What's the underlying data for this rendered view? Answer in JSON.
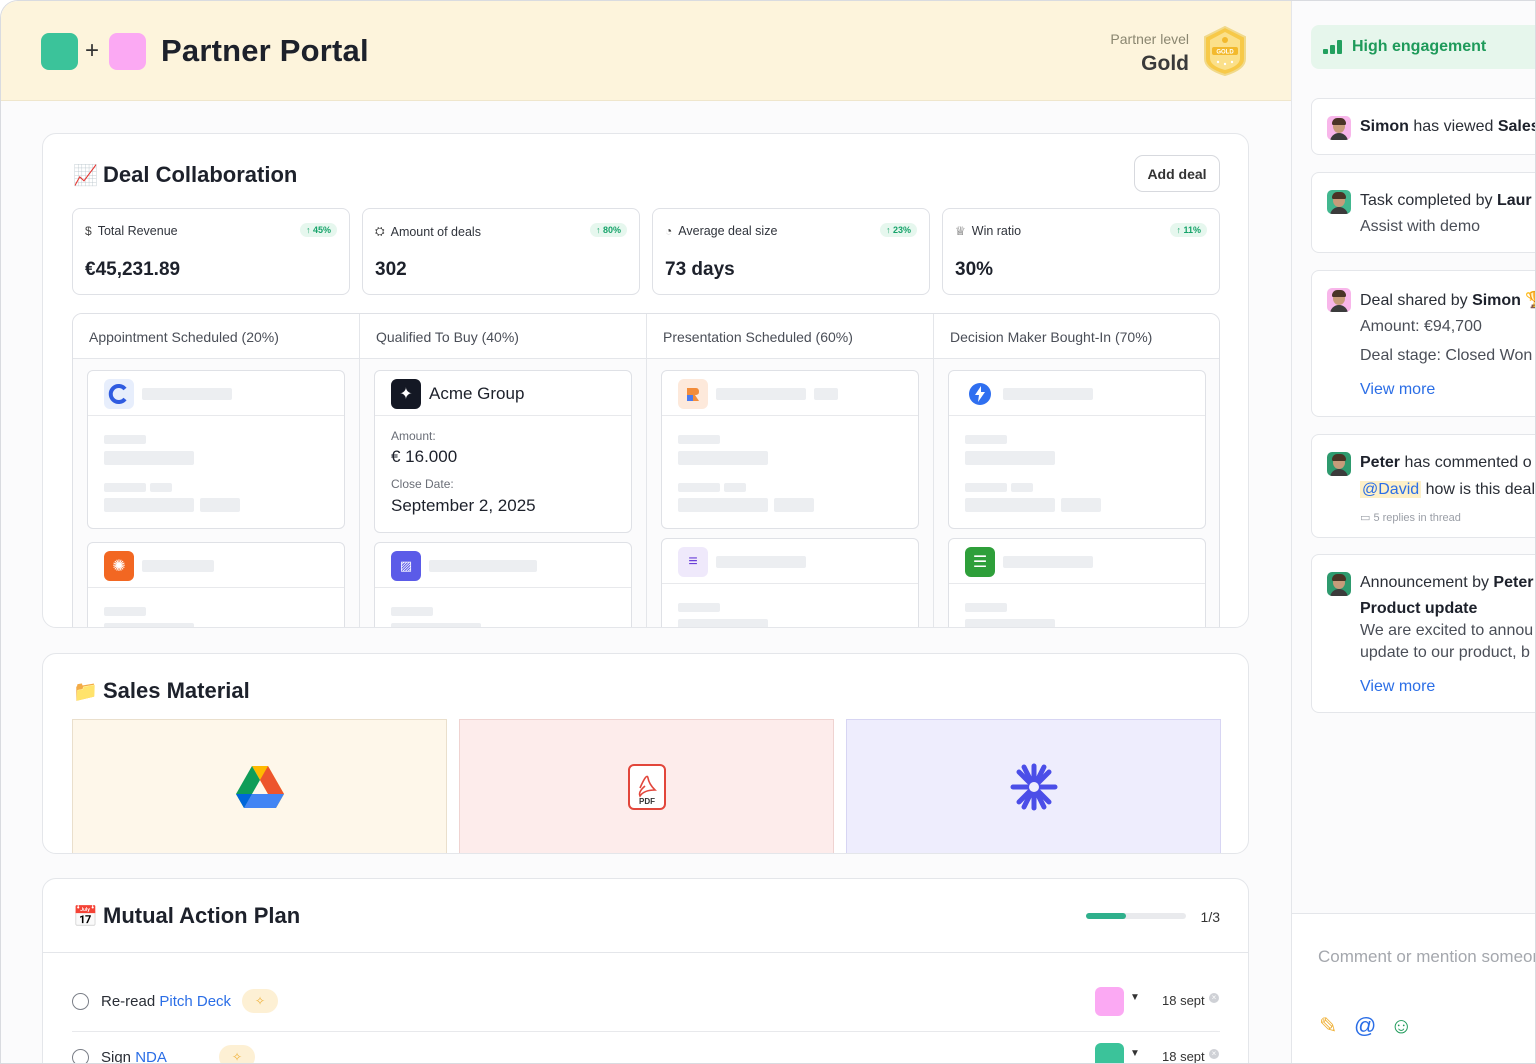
{
  "app": {
    "title": "Partner Portal",
    "logo_plus": "+",
    "partner_level_label": "Partner level",
    "partner_level": "Gold",
    "badge_text": "GOLD"
  },
  "deal_collaboration": {
    "title": "Deal Collaboration",
    "icon": "chart-increasing-icon",
    "add_button": "Add deal",
    "stats": [
      {
        "icon": "dollar-icon",
        "label": "Total Revenue",
        "delta": "↑ 45%",
        "value": "€45,231.89"
      },
      {
        "icon": "handshake-icon",
        "label": "Amount of deals",
        "delta": "↑ 80%",
        "value": "302"
      },
      {
        "icon": "pie-chart-icon",
        "label": "Average deal size",
        "delta": "↑ 23%",
        "value": "73 days"
      },
      {
        "icon": "trophy-icon",
        "label": "Win ratio",
        "delta": "↑ 11%",
        "value": "30%"
      }
    ],
    "stages": [
      {
        "label": "Appointment Scheduled (20%)"
      },
      {
        "label": "Qualified To Buy (40%)"
      },
      {
        "label": "Presentation Scheduled (60%)"
      },
      {
        "label": "Decision Maker Bought-In (70%)"
      }
    ],
    "featured_deal": {
      "company": "Acme Group",
      "amount_label": "Amount:",
      "amount": "€ 16.000",
      "close_label": "Close Date:",
      "close_date": "September 2, 2025"
    }
  },
  "sales_material": {
    "title": "Sales Material",
    "icon": "folder-icon",
    "items": [
      {
        "icon": "google-drive-icon",
        "bg": "#fef7ea"
      },
      {
        "icon": "pdf-icon",
        "label": "PDF",
        "bg": "#fdeceb"
      },
      {
        "icon": "asterisk-icon",
        "bg": "#eeedfd"
      }
    ]
  },
  "mutual_action_plan": {
    "title": "Mutual Action Plan",
    "icon": "calendar-icon",
    "progress": 0.4,
    "progress_text": "1/3",
    "tasks": [
      {
        "prefix": "Re-read ",
        "link": "Pitch Deck",
        "owner_color": "#fba9f3",
        "date": "18 sept"
      },
      {
        "prefix": "Sign ",
        "link": "NDA",
        "owner_color": "#3bc39a",
        "date": "18 sept"
      }
    ]
  },
  "activity": {
    "engagement": "High engagement",
    "feed": [
      {
        "actor": "Simon",
        "text": " has viewed ",
        "object": "Sales"
      },
      {
        "text": "Task completed by ",
        "actor": "Laur",
        "detail": "Assist with demo"
      },
      {
        "text": "Deal shared by ",
        "actor": "Simon",
        "trophy": "🏆",
        "amount": "Amount: €94,700",
        "stage": "Deal stage: Closed Won",
        "link": "View more"
      },
      {
        "actor": "Peter",
        "text": " has commented o",
        "mention": "@David",
        "comment": " how is this deal g",
        "replies": "5 replies in thread"
      },
      {
        "text": "Announcement by ",
        "actor": "Peter",
        "headline": "Product update",
        "body1": "We are excited to annou",
        "body2": "update to our product, b",
        "link": "View more"
      }
    ],
    "comment_placeholder": "Comment or mention someone"
  },
  "colors": {
    "topbar": "#fdf4dc",
    "accent_green": "#3bc39a",
    "accent_pink": "#fba9f3",
    "link_blue": "#2b6ee6",
    "engage_green": "#1e9a5a"
  }
}
